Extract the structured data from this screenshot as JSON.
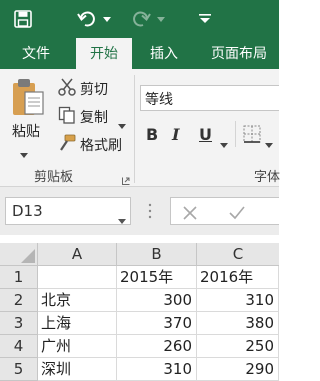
{
  "tabs": [
    "文件",
    "开始",
    "插入",
    "页面布局"
  ],
  "active_tab": "开始",
  "ribbon": {
    "clipboard": {
      "paste": "粘贴",
      "cut": "剪切",
      "copy": "复制",
      "format_painter": "格式刷",
      "group_label": "剪贴板"
    },
    "font": {
      "font_name": "等线",
      "bold": "B",
      "italic": "I",
      "underline": "U",
      "group_label": "字体"
    }
  },
  "formula_bar": {
    "name_box": "D13"
  },
  "columns": [
    "A",
    "B",
    "C"
  ],
  "rows": [
    {
      "num": "1",
      "a": "",
      "b": "2015年",
      "c": "2016年"
    },
    {
      "num": "2",
      "a": "北京",
      "b": "300",
      "c": "310"
    },
    {
      "num": "3",
      "a": "上海",
      "b": "370",
      "c": "380"
    },
    {
      "num": "4",
      "a": "广州",
      "b": "260",
      "c": "250"
    },
    {
      "num": "5",
      "a": "深圳",
      "b": "310",
      "c": "290"
    }
  ],
  "colors": {
    "excel_green": "#217346",
    "ribbon_bg": "#f3f3f3"
  }
}
